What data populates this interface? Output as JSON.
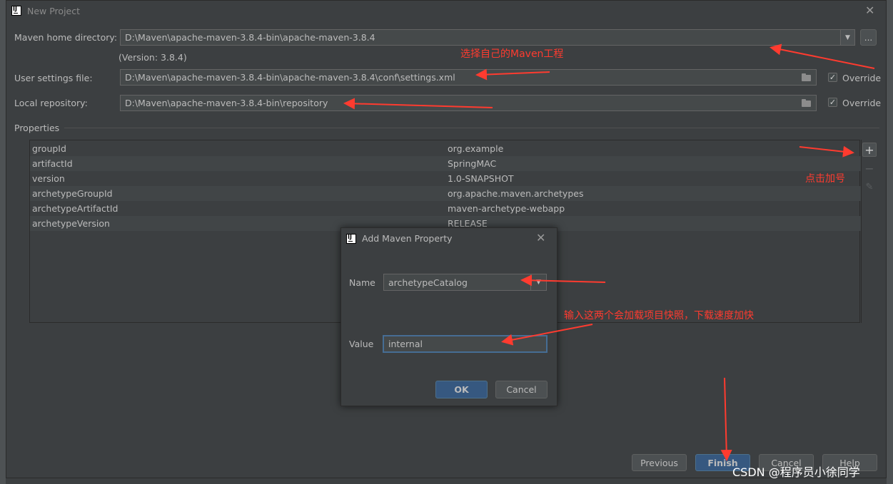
{
  "window": {
    "title": "New Project"
  },
  "maven_home": {
    "label": "Maven home directory:",
    "value": "D:\\Maven\\apache-maven-3.8.4-bin\\apache-maven-3.8.4",
    "version": "(Version: 3.8.4)",
    "more_label": "..."
  },
  "user_settings": {
    "label": "User settings file:",
    "value": "D:\\Maven\\apache-maven-3.8.4-bin\\apache-maven-3.8.4\\conf\\settings.xml",
    "override_label": "Override",
    "override_checked": true
  },
  "local_repo": {
    "label": "Local repository:",
    "value": "D:\\Maven\\apache-maven-3.8.4-bin\\repository",
    "override_label": "Override",
    "override_checked": true
  },
  "properties": {
    "section_label": "Properties",
    "rows": [
      {
        "key": "groupId",
        "value": "org.example"
      },
      {
        "key": "artifactId",
        "value": "SpringMAC"
      },
      {
        "key": "version",
        "value": "1.0-SNAPSHOT"
      },
      {
        "key": "archetypeGroupId",
        "value": "org.apache.maven.archetypes"
      },
      {
        "key": "archetypeArtifactId",
        "value": "maven-archetype-webapp"
      },
      {
        "key": "archetypeVersion",
        "value": "RELEASE"
      }
    ]
  },
  "toolbar": {
    "add_icon": "plus-icon",
    "remove_icon": "minus-icon",
    "edit_icon": "pencil-icon"
  },
  "dialog": {
    "title": "Add Maven Property",
    "name_label": "Name",
    "name_value": "archetypeCatalog",
    "value_label": "Value",
    "value_value": "internal",
    "ok_label": "OK",
    "cancel_label": "Cancel"
  },
  "footer": {
    "previous_label": "Previous",
    "finish_label": "Finish",
    "cancel_label": "Cancel",
    "help_label": "Help"
  },
  "annotations": {
    "select_maven": "选择自己的Maven工程",
    "click_plus": "点击加号",
    "input_hint": "输入这两个会加载项目快照，下载速度加快"
  },
  "watermark": "CSDN @程序员小徐同学",
  "colors": {
    "background": "#3c3f41",
    "field": "#45494a",
    "accent_blue": "#365880",
    "annotation_red": "#ff3b2f"
  }
}
